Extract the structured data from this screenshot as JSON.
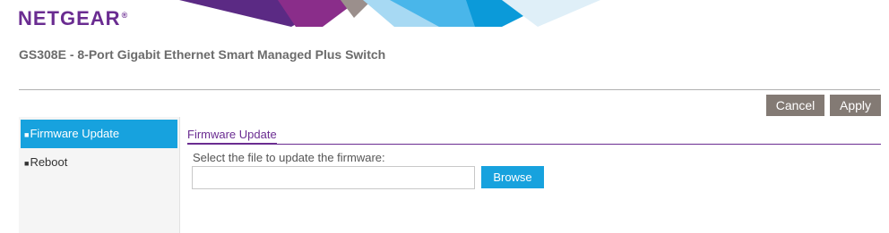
{
  "header": {
    "logo_text": "NETGEAR",
    "logo_mark": "®",
    "product_title": "GS308E - 8-Port Gigabit Ethernet Smart Managed Plus Switch"
  },
  "toolbar": {
    "cancel_label": "Cancel",
    "apply_label": "Apply"
  },
  "sidebar": {
    "items": [
      {
        "label": "Firmware Update",
        "active": true
      },
      {
        "label": "Reboot",
        "active": false
      }
    ]
  },
  "main": {
    "tab_label": "Firmware Update",
    "instruction": "Select the file to update the firmware:",
    "file_value": "",
    "browse_label": "Browse"
  },
  "colors": {
    "brand_purple": "#6a2c91",
    "accent_blue": "#17a2de",
    "button_gray": "#837a74"
  }
}
